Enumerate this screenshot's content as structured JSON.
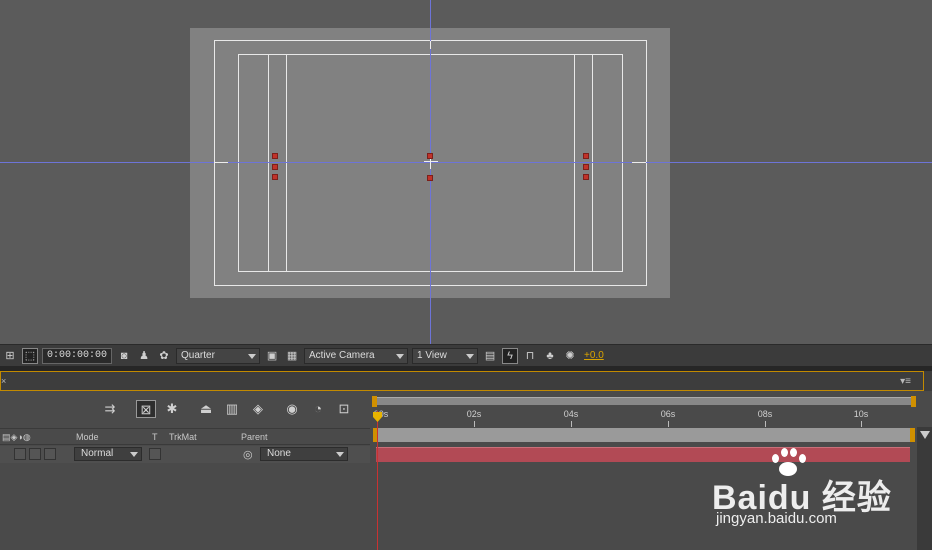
{
  "viewer_toolbar": {
    "timecode": "0:00:00:00",
    "resolution": "Quarter",
    "view": "Active Camera",
    "layout": "1 View",
    "exposure": "+0.0"
  },
  "timeline": {
    "columns": {
      "mode": "Mode",
      "t": "T",
      "trkmat": "TrkMat",
      "parent": "Parent"
    },
    "layer": {
      "mode": "Normal",
      "parent": "None"
    },
    "ruler_labels": [
      "00s",
      "02s",
      "04s",
      "06s",
      "08s",
      "10s"
    ]
  },
  "colors": {
    "guide": "#6d74d8",
    "layer_bar": "#b24a55",
    "accent": "#d09000",
    "playhead": "#c83232"
  },
  "watermark": {
    "logo": "Baidu 经验",
    "sub": "jingyan.baidu.com"
  }
}
